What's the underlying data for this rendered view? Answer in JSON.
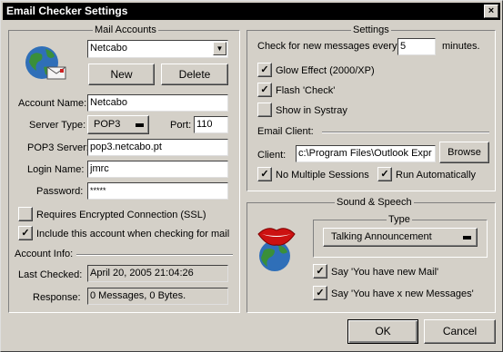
{
  "window": {
    "title": "Email Checker Settings",
    "close_glyph": "×"
  },
  "mail_accounts": {
    "legend": "Mail Accounts",
    "selected_account": "Netcabo",
    "new_label": "New",
    "delete_label": "Delete",
    "account_name_label": "Account Name:",
    "account_name_value": "Netcabo",
    "server_type_label": "Server Type:",
    "server_type_value": "POP3",
    "port_label": "Port:",
    "port_value": "110",
    "pop3_server_label": "POP3 Server:",
    "pop3_server_value": "pop3.netcabo.pt",
    "login_name_label": "Login Name:",
    "login_name_value": "jmrc",
    "password_label": "Password:",
    "password_value": "*****",
    "ssl_label": "Requires Encrypted Connection (SSL)",
    "ssl_checked": false,
    "include_label": "Include this account when checking for mail",
    "include_checked": true
  },
  "account_info": {
    "legend": "Account Info:",
    "last_checked_label": "Last Checked:",
    "last_checked_value": "April 20, 2005 21:04:26",
    "response_label": "Response:",
    "response_value": "0 Messages, 0 Bytes."
  },
  "settings": {
    "legend": "Settings",
    "check_prefix": "Check for new messages every",
    "check_minutes": "5",
    "check_suffix": "minutes.",
    "glow_label": "Glow Effect (2000/XP)",
    "glow_checked": true,
    "flash_label": "Flash 'Check'",
    "flash_checked": true,
    "systray_label": "Show in Systray",
    "systray_checked": false,
    "email_client_label": "Email Client:",
    "client_label": "Client:",
    "client_value": "c:\\Program Files\\Outlook Expr",
    "browse_label": "Browse",
    "no_multiple_label": "No Multiple Sessions",
    "no_multiple_checked": true,
    "run_auto_label": "Run Automatically",
    "run_auto_checked": true
  },
  "sound": {
    "legend": "Sound & Speech",
    "type_legend": "Type",
    "type_value": "Talking Announcement",
    "say_new_mail_label": "Say 'You have new Mail'",
    "say_new_mail_checked": true,
    "say_x_messages_label": "Say 'You have x new Messages'",
    "say_x_messages_checked": true
  },
  "footer": {
    "ok_label": "OK",
    "cancel_label": "Cancel"
  },
  "icons": {
    "check_glyph": "✓",
    "dropdown_glyph": "▼",
    "colors": {
      "globe_ocean": "#2f6fb8",
      "globe_land": "#3a8f3a",
      "lips": "#cc1111"
    }
  }
}
